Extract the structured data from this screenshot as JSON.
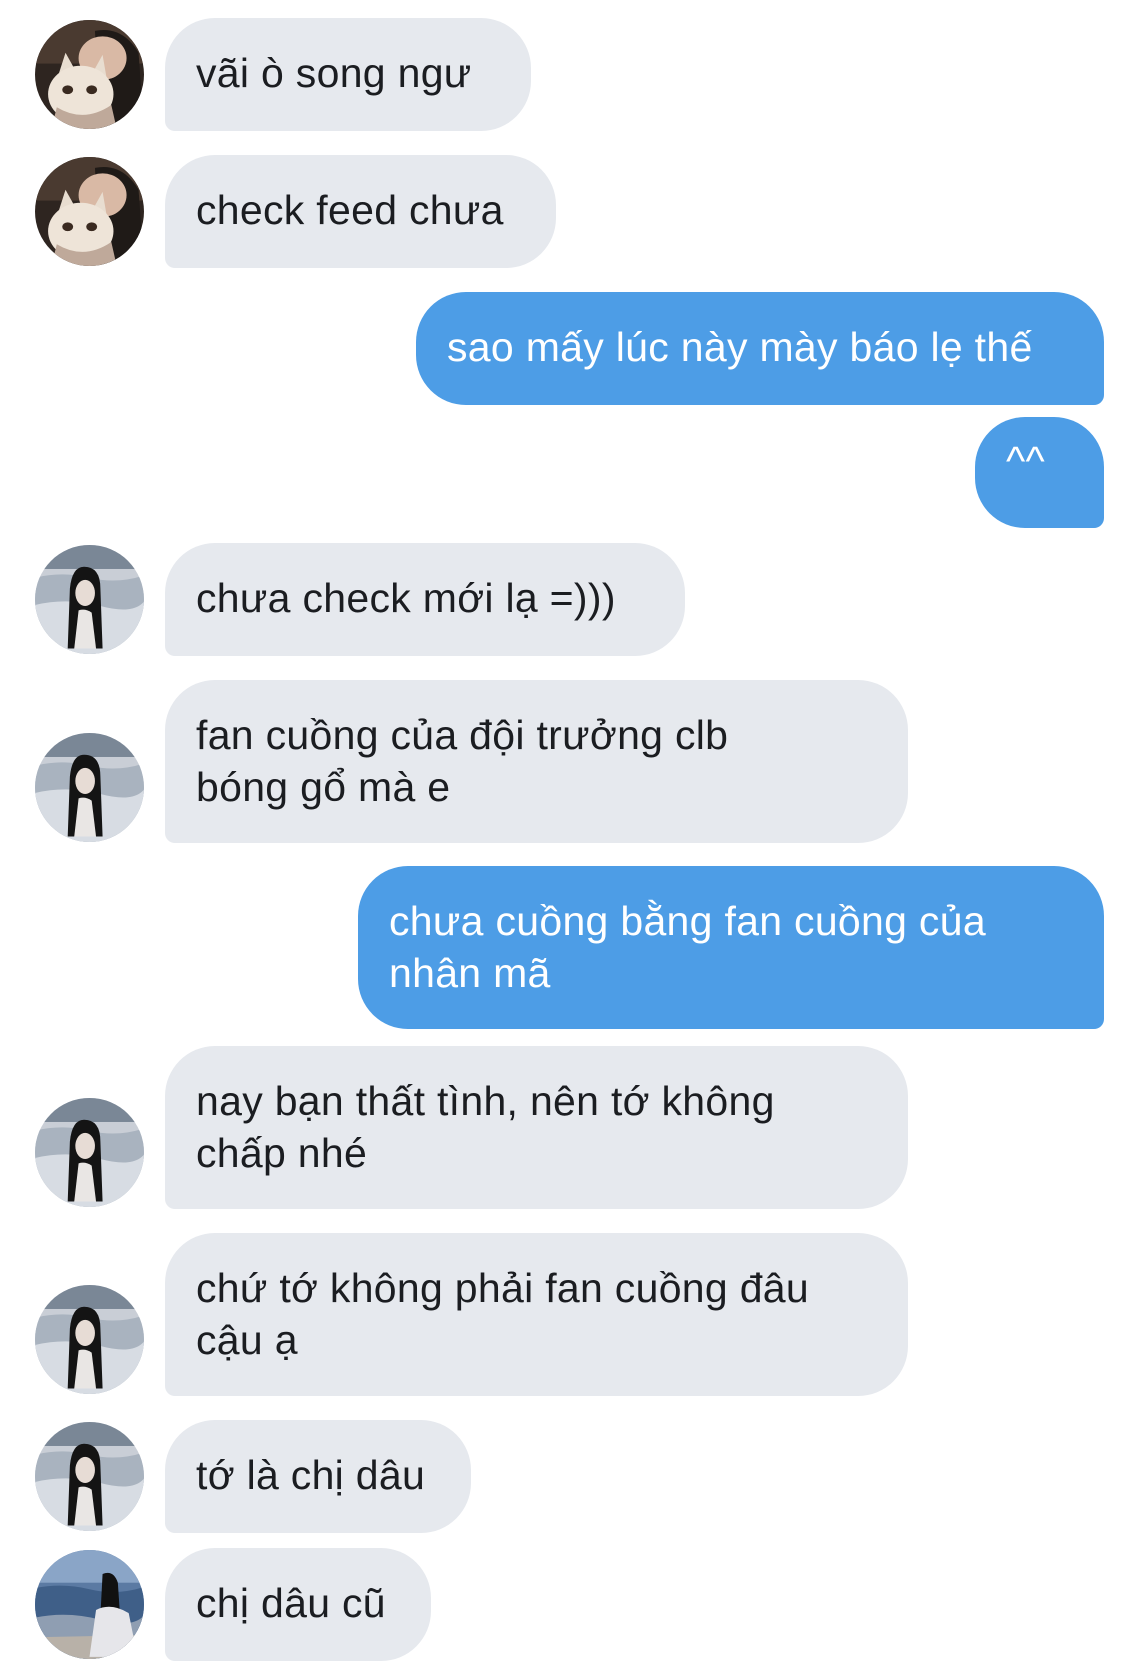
{
  "conversation": {
    "messages": [
      {
        "sender": "them",
        "text": "vãi ò song ngư",
        "avatar_icon": "profile-photo-cat-icon"
      },
      {
        "sender": "them",
        "text": "check feed chưa",
        "avatar_icon": "profile-photo-cat-icon"
      },
      {
        "sender": "me",
        "text": "sao mấy lúc này mày báo lẹ thế"
      },
      {
        "sender": "me",
        "text": "^^"
      },
      {
        "sender": "them",
        "text": "chưa check mới lạ =)))",
        "avatar_icon": "profile-photo-girl-beach-icon"
      },
      {
        "sender": "them",
        "text": "fan cuồng của đội trưởng clb\nbóng gổ mà e",
        "avatar_icon": "profile-photo-girl-beach-icon"
      },
      {
        "sender": "me",
        "text": "chưa cuồng bằng fan cuồng của\nnhân mã"
      },
      {
        "sender": "them",
        "text": "nay bạn thất tình, nên tớ không\nchấp nhé",
        "avatar_icon": "profile-photo-girl-beach-icon"
      },
      {
        "sender": "them",
        "text": "chứ tớ không phải fan cuồng đâu\ncậu ạ",
        "avatar_icon": "profile-photo-girl-beach-icon"
      },
      {
        "sender": "them",
        "text": "tớ là chị dâu",
        "avatar_icon": "profile-photo-girl-beach-icon"
      },
      {
        "sender": "them",
        "text": "chị dâu cũ",
        "avatar_icon": "profile-photo-girl-sea-icon"
      }
    ]
  },
  "colors": {
    "incoming_bubble": "#e6e9ee",
    "incoming_text": "#1b1d21",
    "outgoing_bubble": "#4d9de6",
    "outgoing_text": "#ffffff",
    "background": "#ffffff"
  }
}
